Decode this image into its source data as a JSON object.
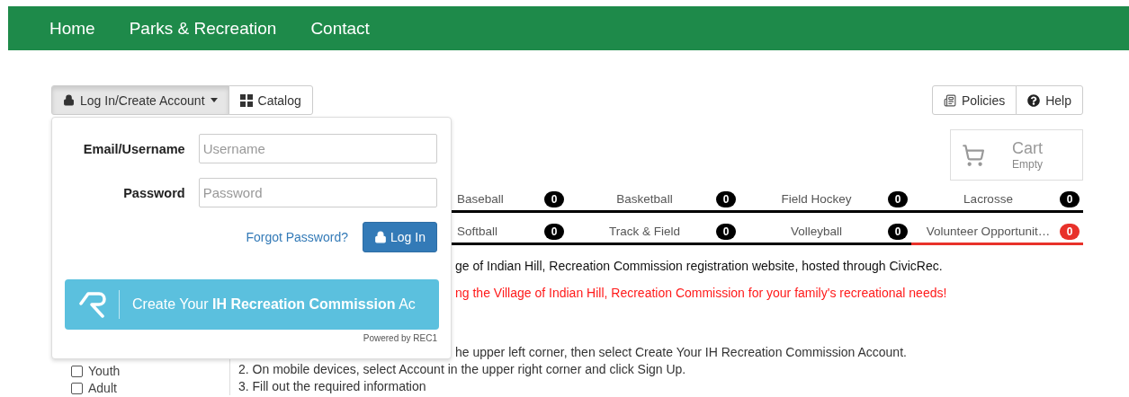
{
  "nav": {
    "items": [
      "Home",
      "Parks & Recreation",
      "Contact"
    ]
  },
  "toolbar": {
    "login": {
      "label": "Log In/Create Account",
      "expanded": true
    },
    "catalog": "Catalog",
    "policies": "Policies",
    "help": "Help"
  },
  "cart": {
    "title": "Cart",
    "status": "Empty"
  },
  "login_form": {
    "fields": [
      {
        "label": "Email/Username",
        "placeholder": "Username"
      },
      {
        "label": "Password",
        "placeholder": "Password"
      }
    ],
    "forgot": "Forgot Password?",
    "submit": "Log In",
    "create": "Create Your **IH Recreation Commission** Ac",
    "powered": "Powered by REC1"
  },
  "categories": [
    {
      "name": "Baseball",
      "count": "0",
      "color": "#000000"
    },
    {
      "name": "Basketball",
      "count": "0",
      "color": "#000000"
    },
    {
      "name": "Field Hockey",
      "count": "0",
      "color": "#000000"
    },
    {
      "name": "Lacrosse",
      "count": "0",
      "color": "#000000"
    },
    {
      "name": "Softball",
      "count": "0",
      "color": "#000000"
    },
    {
      "name": "Track & Field",
      "count": "0",
      "color": "#000000"
    },
    {
      "name": "Volleyball",
      "count": "0",
      "color": "#000000"
    },
    {
      "name": "Volunteer Opportunit…",
      "count": "0",
      "color": "#e8312a"
    }
  ],
  "content": {
    "intro": "ge of Indian Hill, Recreation Commission registration website, hosted through CivicRec.",
    "notice": "ng the Village of Indian Hill, Recreation Commission for your family's recreational needs!",
    "steps": [
      "he upper left corner, then select Create Your IH Recreation Commission Account.",
      "2. On mobile devices, select Account in the upper right corner and click Sign Up.",
      "3. Fill out the required information"
    ]
  },
  "filters": [
    {
      "label": "Youth",
      "checked": false
    },
    {
      "label": "Adult",
      "checked": false
    }
  ]
}
